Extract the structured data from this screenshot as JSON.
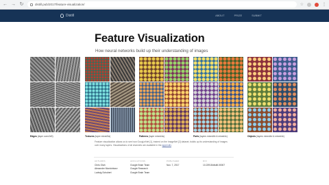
{
  "browser": {
    "url": "distill.pub/2017/feature-visualization/"
  },
  "site": {
    "logo_text": "Distill",
    "nav": [
      "ABOUT",
      "PRIZE",
      "SUBMIT"
    ]
  },
  "article": {
    "title": "Feature Visualization",
    "subtitle": "How neural networks build up their understanding of images"
  },
  "figure": {
    "groups": [
      {
        "name": "Edges",
        "desc": "(layer conv2d0)"
      },
      {
        "name": "Textures",
        "desc": "(layer mixed3a)"
      },
      {
        "name": "Patterns",
        "desc": "(layer mixed4a)"
      },
      {
        "name": "Parts",
        "desc": "(layers mixed4b & mixed4c)"
      },
      {
        "name": "Objects",
        "desc": "(layers mixed4d & mixed4e)"
      }
    ],
    "caption_main": "Feature visualization allows us to see how GoogLeNet [1], trained on the ImageNet [2] dataset, builds up its understanding of images over many layers. Visualizations of all channels are available in the",
    "caption_link": "appendix",
    "caption_end": "."
  },
  "byline": {
    "authors_label": "AUTHORS",
    "authors": [
      "Chris Olah",
      "Alexander Mordvintsev",
      "Ludwig Schubert"
    ],
    "affiliations_label": "AFFILIATIONS",
    "affiliations": [
      "Google Brain Team",
      "Google Research",
      "Google Brain Team"
    ],
    "published_label": "PUBLISHED",
    "published": "Nov. 7, 2017",
    "doi_label": "DOI",
    "doi": "10.23915/distill.00007"
  }
}
